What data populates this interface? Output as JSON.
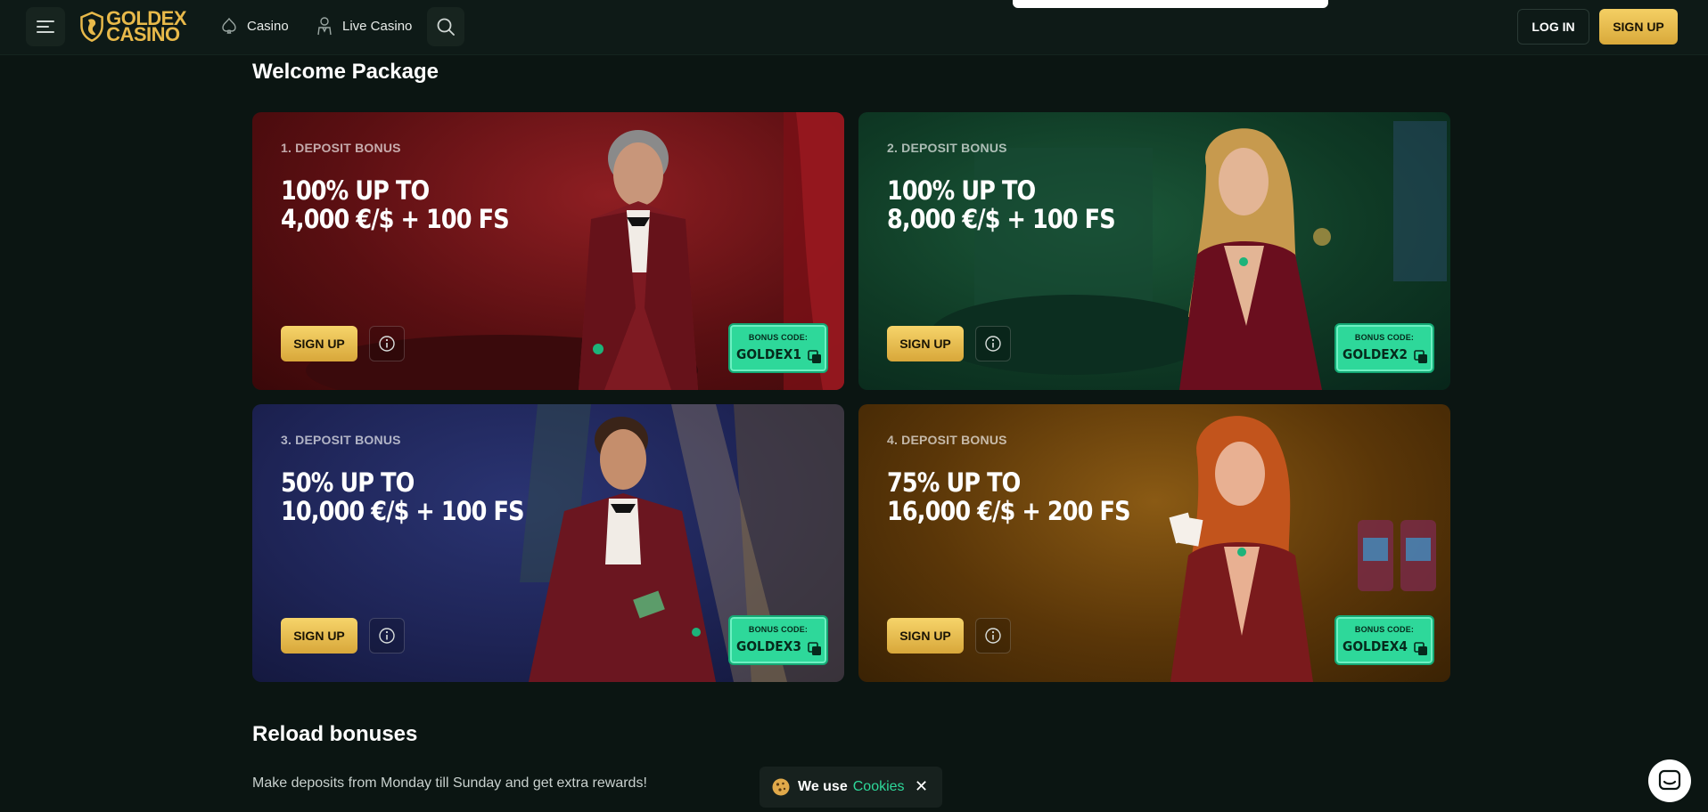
{
  "header": {
    "logo_line1": "GOLDEX",
    "logo_line2": "CASINO",
    "nav": [
      {
        "label": "Casino",
        "icon": "spade-icon"
      },
      {
        "label": "Live Casino",
        "icon": "dealer-icon"
      }
    ],
    "login_label": "LOG IN",
    "signup_label": "SIGN UP"
  },
  "welcome": {
    "title": "Welcome Package",
    "cards": [
      {
        "label": "1. DEPOSIT BONUS",
        "line1": "100% UP TO",
        "line2": "4,000 €/$ + 100 FS",
        "signup": "SIGN UP",
        "code_label": "BONUS CODE:",
        "code": "GOLDEX1",
        "theme": "#6b1418"
      },
      {
        "label": "2. DEPOSIT BONUS",
        "line1": "100% UP TO",
        "line2": "8,000 €/$ + 100 FS",
        "signup": "SIGN UP",
        "code_label": "BONUS CODE:",
        "code": "GOLDEX2",
        "theme": "#0f3a25"
      },
      {
        "label": "3. DEPOSIT BONUS",
        "line1": "50% UP TO",
        "line2": "10,000 €/$ + 100 FS",
        "signup": "SIGN UP",
        "code_label": "BONUS CODE:",
        "code": "GOLDEX3",
        "theme": "#1e2456"
      },
      {
        "label": "4. DEPOSIT BONUS",
        "line1": "75% UP TO",
        "line2": "16,000 €/$ + 200 FS",
        "signup": "SIGN UP",
        "code_label": "BONUS CODE:",
        "code": "GOLDEX4",
        "theme": "#5a3608"
      }
    ]
  },
  "reload": {
    "title": "Reload bonuses",
    "description": "Make deposits from Monday till Sunday and get extra rewards!"
  },
  "cookies": {
    "text": "We use",
    "link": "Cookies",
    "close": "✕"
  },
  "colors": {
    "accent_gold": "#e8b94a",
    "accent_green": "#2ed89a",
    "background": "#0b1512"
  }
}
